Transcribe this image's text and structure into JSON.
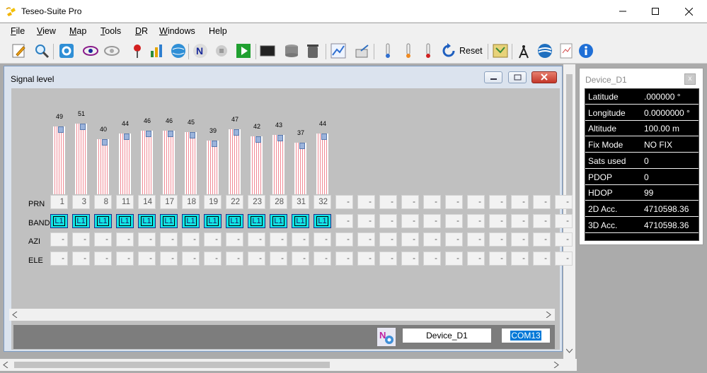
{
  "window": {
    "title": "Teseo-Suite Pro",
    "icon": "satellite-icon"
  },
  "menu": [
    {
      "key": "F",
      "rest": "ile"
    },
    {
      "key": "V",
      "rest": "iew"
    },
    {
      "key": "M",
      "rest": "ap"
    },
    {
      "key": "T",
      "rest": "ools"
    },
    {
      "key": "D",
      "rest": "R"
    },
    {
      "key": "W",
      "rest": "indows"
    },
    {
      "key": "",
      "rest": "Help"
    }
  ],
  "toolbar": {
    "reset_label": "Reset"
  },
  "signal_window": {
    "title": "Signal level",
    "row_labels": {
      "prn": "PRN",
      "band": "BAND",
      "azi": "AZI",
      "ele": "ELE"
    },
    "satellites": [
      {
        "prn": "1",
        "snr": 49,
        "band": "L1",
        "azi": "-",
        "ele": "-"
      },
      {
        "prn": "3",
        "snr": 51,
        "band": "L1",
        "azi": "-",
        "ele": "-"
      },
      {
        "prn": "8",
        "snr": 40,
        "band": "L1",
        "azi": "-",
        "ele": "-"
      },
      {
        "prn": "11",
        "snr": 44,
        "band": "L1",
        "azi": "-",
        "ele": "-"
      },
      {
        "prn": "14",
        "snr": 46,
        "band": "L1",
        "azi": "-",
        "ele": "-"
      },
      {
        "prn": "17",
        "snr": 46,
        "band": "L1",
        "azi": "-",
        "ele": "-"
      },
      {
        "prn": "18",
        "snr": 45,
        "band": "L1",
        "azi": "-",
        "ele": "-"
      },
      {
        "prn": "19",
        "snr": 39,
        "band": "L1",
        "azi": "-",
        "ele": "-"
      },
      {
        "prn": "22",
        "snr": 47,
        "band": "L1",
        "azi": "-",
        "ele": "-"
      },
      {
        "prn": "23",
        "snr": 42,
        "band": "L1",
        "azi": "-",
        "ele": "-"
      },
      {
        "prn": "28",
        "snr": 43,
        "band": "L1",
        "azi": "-",
        "ele": "-"
      },
      {
        "prn": "31",
        "snr": 37,
        "band": "L1",
        "azi": "-",
        "ele": "-"
      },
      {
        "prn": "32",
        "snr": 44,
        "band": "L1",
        "azi": "-",
        "ele": "-"
      }
    ],
    "empty_cell": "-",
    "status": {
      "device": "Device_D1",
      "port": "COM13"
    }
  },
  "device_panel": {
    "title": "Device_D1",
    "rows": [
      {
        "label": "Latitude",
        "value": ".000000 °"
      },
      {
        "label": "Longitude",
        "value": "0.0000000 °"
      },
      {
        "label": "Altitude",
        "value": "100.00 m"
      },
      {
        "label": "Fix Mode",
        "value": "NO FIX"
      },
      {
        "label": "Sats used",
        "value": "0"
      },
      {
        "label": "PDOP",
        "value": "0"
      },
      {
        "label": "HDOP",
        "value": "99"
      },
      {
        "label": "2D Acc.",
        "value": "4710598.36"
      },
      {
        "label": "3D Acc.",
        "value": "4710598.36"
      }
    ]
  }
}
